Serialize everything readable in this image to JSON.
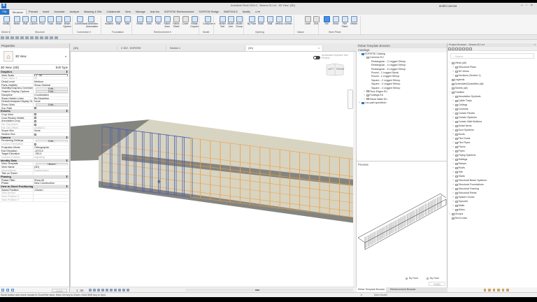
{
  "window": {
    "title": "Autodesk Revit 2024.2 - Beams EU.rvt - 3D View: {3D}",
    "user": "andrei.carcea",
    "app_icon": "R"
  },
  "ribbon_tabs": [
    "File",
    "Structure",
    "Precast",
    "Insert",
    "Annotate",
    "Analyze",
    "Massing & Site",
    "Collaborate",
    "View",
    "Manage",
    "Add-Ins",
    "SOFiSTiK Reinforcement",
    "SOFiSTiK Bridge",
    "BIMTOOLS",
    "Modify",
    "▭ ▾"
  ],
  "ribbon_active_tab": "Structure",
  "ribbon_buttons": [
    "Modify",
    "Beam",
    "Wall",
    "Column",
    "Floor",
    "Truss",
    "Brace",
    "Beam System",
    "Connection",
    "Connection Automation",
    "Isolated",
    "Wall",
    "Slab",
    "Rebar",
    "Area",
    "Path",
    "Fabric Area",
    "Fabric Sheet",
    "Cover",
    "Rebar Coupler",
    "Component",
    "Model Text",
    "Model Line",
    "Model Group",
    "By Face",
    "Shaft",
    "Wall",
    "Vertical",
    "Dormer",
    "Level",
    "Grid",
    "Set",
    "Show",
    "Ref Plane",
    "Viewer"
  ],
  "ribbon_panels": [
    "Select ▾",
    "Structure",
    "Connection ▾",
    "Foundation",
    "Reinforcement ▾",
    "Model",
    "Opening",
    "Datum",
    "Work Plane"
  ],
  "properties": {
    "header": "Properties",
    "type_name": "3D View",
    "instance": "3D View: {3D}",
    "edit_type": "Edit Type",
    "apply": "Apply",
    "sections": [
      {
        "title": "Graphics",
        "rows": [
          [
            "View Scale",
            "1 : 50",
            "input"
          ],
          [
            "Scale Value    1",
            "50",
            "dis"
          ],
          [
            "Detail Level",
            "Medium"
          ],
          [
            "Parts Visibility",
            "Show Original"
          ],
          [
            "Visibility/Graphics Overrides",
            "Edit...",
            "btn"
          ],
          [
            "Graphic Display Options",
            "Edit...",
            "btn"
          ],
          [
            "Discipline",
            "Coordination"
          ],
          [
            "Show Hidden Lines",
            "By Discipline"
          ],
          [
            "Default Analysis Display St...",
            "None"
          ],
          [
            "Show Grids",
            "Edit...",
            "btn"
          ],
          [
            "Sun Path",
            "",
            "cb"
          ]
        ]
      },
      {
        "title": "Extents",
        "rows": [
          [
            "Crop View",
            "",
            "cb"
          ],
          [
            "Crop Region Visible",
            "",
            "cb"
          ],
          [
            "Annotation Crop",
            "",
            "cb"
          ],
          [
            "Far Clip Active",
            "",
            "cbdis"
          ],
          [
            "Far Clip Offset",
            "304800.0",
            "dis"
          ],
          [
            "Scope Box",
            "None"
          ],
          [
            "Section Box",
            "",
            "cb"
          ]
        ]
      },
      {
        "title": "Camera",
        "rows": [
          [
            "Rendering Settings",
            "Edit...",
            "btn"
          ],
          [
            "Locked Orientation",
            "",
            "cbdis"
          ],
          [
            "Projection Mode",
            "Orthographic"
          ],
          [
            "Eye Elevation",
            "-1074.8"
          ],
          [
            "Target Elevation",
            "-750.0"
          ],
          [
            "Camera Position",
            "Adjusting",
            "dis"
          ]
        ]
      },
      {
        "title": "Identity Data",
        "rows": [
          [
            "View Template",
            "<None>",
            "btn"
          ],
          [
            "View Name",
            "{3D}"
          ],
          [
            "Dependency",
            "Independent",
            "dis"
          ],
          [
            "Title on Sheet",
            ""
          ]
        ]
      },
      {
        "title": "Phasing",
        "rows": [
          [
            "Phase Filter",
            "Show All"
          ],
          [
            "Phase",
            "New Construction"
          ]
        ]
      },
      {
        "title": "View to Sheet Positioning",
        "rows": [
          [
            "Saved Position",
            "<None>"
          ],
          [
            "View Anchor",
            "",
            "dis"
          ],
          [
            "View Position X",
            "",
            "dis"
          ],
          [
            "View Position Y",
            "",
            "dis"
          ]
        ]
      }
    ]
  },
  "view_tabs": [
    {
      "label": "{3D}"
    },
    {
      "label": "C 502 - SOFiSTiK"
    },
    {
      "label": "Section 1"
    },
    {
      "label": "{3D}",
      "active": true,
      "close": "×"
    }
  ],
  "viewport": {
    "accelerated_graphics": "Accelerated Graphics Tech Preview",
    "viewcube": [
      "LEFT",
      "FRONT"
    ],
    "scale": "1 : 50",
    "colors": {
      "stirrup_selected": "#4a5fb0",
      "rebar": "#f0a040",
      "concrete": "#d8d4c2",
      "concrete_dark": "#858580"
    }
  },
  "rebar_browser": {
    "header": "Rebar Template Browser",
    "catalog": "Catalogs",
    "tree": [
      {
        "l": "SOFiSTiK Catalog",
        "d": 0,
        "t": "−",
        "icon": "blue"
      },
      {
        "l": "Columns EU",
        "d": 1,
        "t": "−",
        "icon": "folder"
      },
      {
        "l": "Rectangular - 2 Legged Stirrup",
        "d": 2
      },
      {
        "l": "Rectangular - 4 Legged Stirrup",
        "d": 2
      },
      {
        "l": "Rectangular - 6 Legged Stirrup",
        "d": 2
      },
      {
        "l": "Round - 2 Legged Spiral",
        "d": 2
      },
      {
        "l": "Round - 2 Legged Stirrup",
        "d": 2
      },
      {
        "l": "Square - 2 Legged Stirrup",
        "d": 2
      },
      {
        "l": "Square - 3 Legged Stirrup",
        "d": 2
      },
      {
        "l": "Square - 4 Legged Stirrup",
        "d": 2
      },
      {
        "l": "Floor Edges EU",
        "d": 1,
        "t": "+",
        "icon": "folder"
      },
      {
        "l": "Footings EU",
        "d": 1,
        "t": "+",
        "icon": "folder"
      },
      {
        "l": "Shear Walls EU",
        "d": 1,
        "t": "+",
        "icon": "folder"
      },
      {
        "l": "<no path specified>",
        "d": 0,
        "t": "+",
        "icon": "blue"
      }
    ],
    "preview": "Preview",
    "by_face": "By Face",
    "by_host": "By Host",
    "apply": "Apply",
    "tabs": [
      "Rebar Template Browser",
      "Reinforcement Browser"
    ]
  },
  "project_browser": {
    "header": "Project Browser - Beams EU.rvt",
    "close": "×",
    "search_placeholder": "Search",
    "tree": [
      {
        "l": "Views (all)",
        "d": 0,
        "t": "−"
      },
      {
        "l": "Structural Plans",
        "d": 1,
        "t": "+"
      },
      {
        "l": "3D Views",
        "d": 1,
        "t": "+"
      },
      {
        "l": "Sections (Section 1)",
        "d": 1,
        "t": "+"
      },
      {
        "l": "Legends",
        "d": 0
      },
      {
        "l": "Schedules/Quantities (all)",
        "d": 0
      },
      {
        "l": "Sheets (all)",
        "d": 0
      },
      {
        "l": "Families",
        "d": 0,
        "t": "−"
      },
      {
        "l": "Annotation Symbols",
        "d": 1,
        "t": "+"
      },
      {
        "l": "Cable Trays",
        "d": 1,
        "t": "+"
      },
      {
        "l": "Ceilings",
        "d": 1,
        "t": "+"
      },
      {
        "l": "Conduits",
        "d": 1,
        "t": "+"
      },
      {
        "l": "Curtain Panels",
        "d": 1,
        "t": "+"
      },
      {
        "l": "Curtain Systems",
        "d": 1,
        "t": "+"
      },
      {
        "l": "Curtain Wall Mullions",
        "d": 1,
        "t": "+"
      },
      {
        "l": "Detail Items",
        "d": 1,
        "t": "+"
      },
      {
        "l": "Duct Systems",
        "d": 1,
        "t": "+"
      },
      {
        "l": "Ducts",
        "d": 1,
        "t": "+"
      },
      {
        "l": "Flex Ducts",
        "d": 1,
        "t": "+"
      },
      {
        "l": "Flex Pipes",
        "d": 1,
        "t": "+"
      },
      {
        "l": "Floors",
        "d": 1,
        "t": "+"
      },
      {
        "l": "Pipes",
        "d": 1,
        "t": "+"
      },
      {
        "l": "Piping Systems",
        "d": 1,
        "t": "+"
      },
      {
        "l": "Railings",
        "d": 1,
        "t": "+"
      },
      {
        "l": "Ramps",
        "d": 1,
        "t": "+"
      },
      {
        "l": "Roofs",
        "d": 1,
        "t": "+"
      },
      {
        "l": "Site",
        "d": 1,
        "t": "+"
      },
      {
        "l": "Stairs",
        "d": 1,
        "t": "+"
      },
      {
        "l": "Structural Beam Systems",
        "d": 1,
        "t": "+"
      },
      {
        "l": "Structural Foundations",
        "d": 1,
        "t": "+"
      },
      {
        "l": "Structural Framing",
        "d": 1,
        "t": "+"
      },
      {
        "l": "Structural Rebar",
        "d": 1,
        "t": "+"
      },
      {
        "l": "System Zones",
        "d": 1,
        "t": "+"
      },
      {
        "l": "Topsolid",
        "d": 1,
        "t": "+"
      },
      {
        "l": "Walls",
        "d": 1,
        "t": "+"
      },
      {
        "l": "Wires",
        "d": 1,
        "t": "+"
      },
      {
        "l": "Groups",
        "d": 0,
        "t": "+"
      },
      {
        "l": "Revit Links",
        "d": 0
      }
    ]
  },
  "status": {
    "text": "Scroll button and move mouse to Scroll the view; Hold Ctrl key to Zoom; Hold Shift key to Spin.",
    "model": "Main Model",
    "selection": ":0"
  }
}
